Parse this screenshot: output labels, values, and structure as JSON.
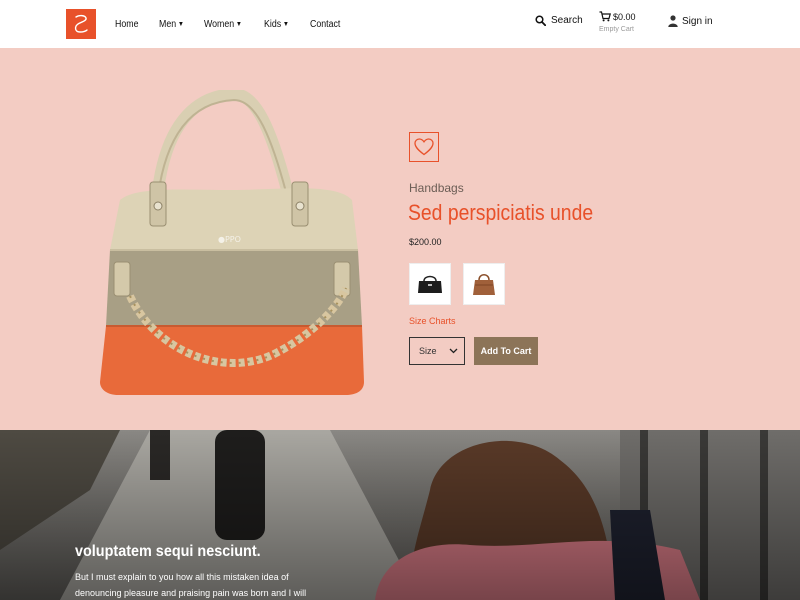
{
  "header": {
    "nav": [
      {
        "label": "Home",
        "dropdown": false
      },
      {
        "label": "Men",
        "dropdown": true
      },
      {
        "label": "Women",
        "dropdown": true
      },
      {
        "label": "Kids",
        "dropdown": true
      },
      {
        "label": "Contact",
        "dropdown": false
      }
    ],
    "search_label": "Search",
    "cart_amount": "$0.00",
    "cart_status": "Empty Cart",
    "signin_label": "Sign in"
  },
  "product": {
    "category": "Handbags",
    "title": "Sed perspiciatis unde",
    "price": "$200.00",
    "size_charts_label": "Size Charts",
    "size_select": "Size",
    "add_to_cart_label": "Add To Cart",
    "thumbnails": [
      "black-handbag",
      "brown-handbag"
    ]
  },
  "banner": {
    "title": "voluptatem sequi nesciunt.",
    "text": "But I must explain to you how all this mistaken idea of denouncing pleasure and praising pain was born and I will"
  },
  "colors": {
    "accent": "#e8512a",
    "hero_bg": "#f3ccc3",
    "button_bg": "#8c7458"
  }
}
